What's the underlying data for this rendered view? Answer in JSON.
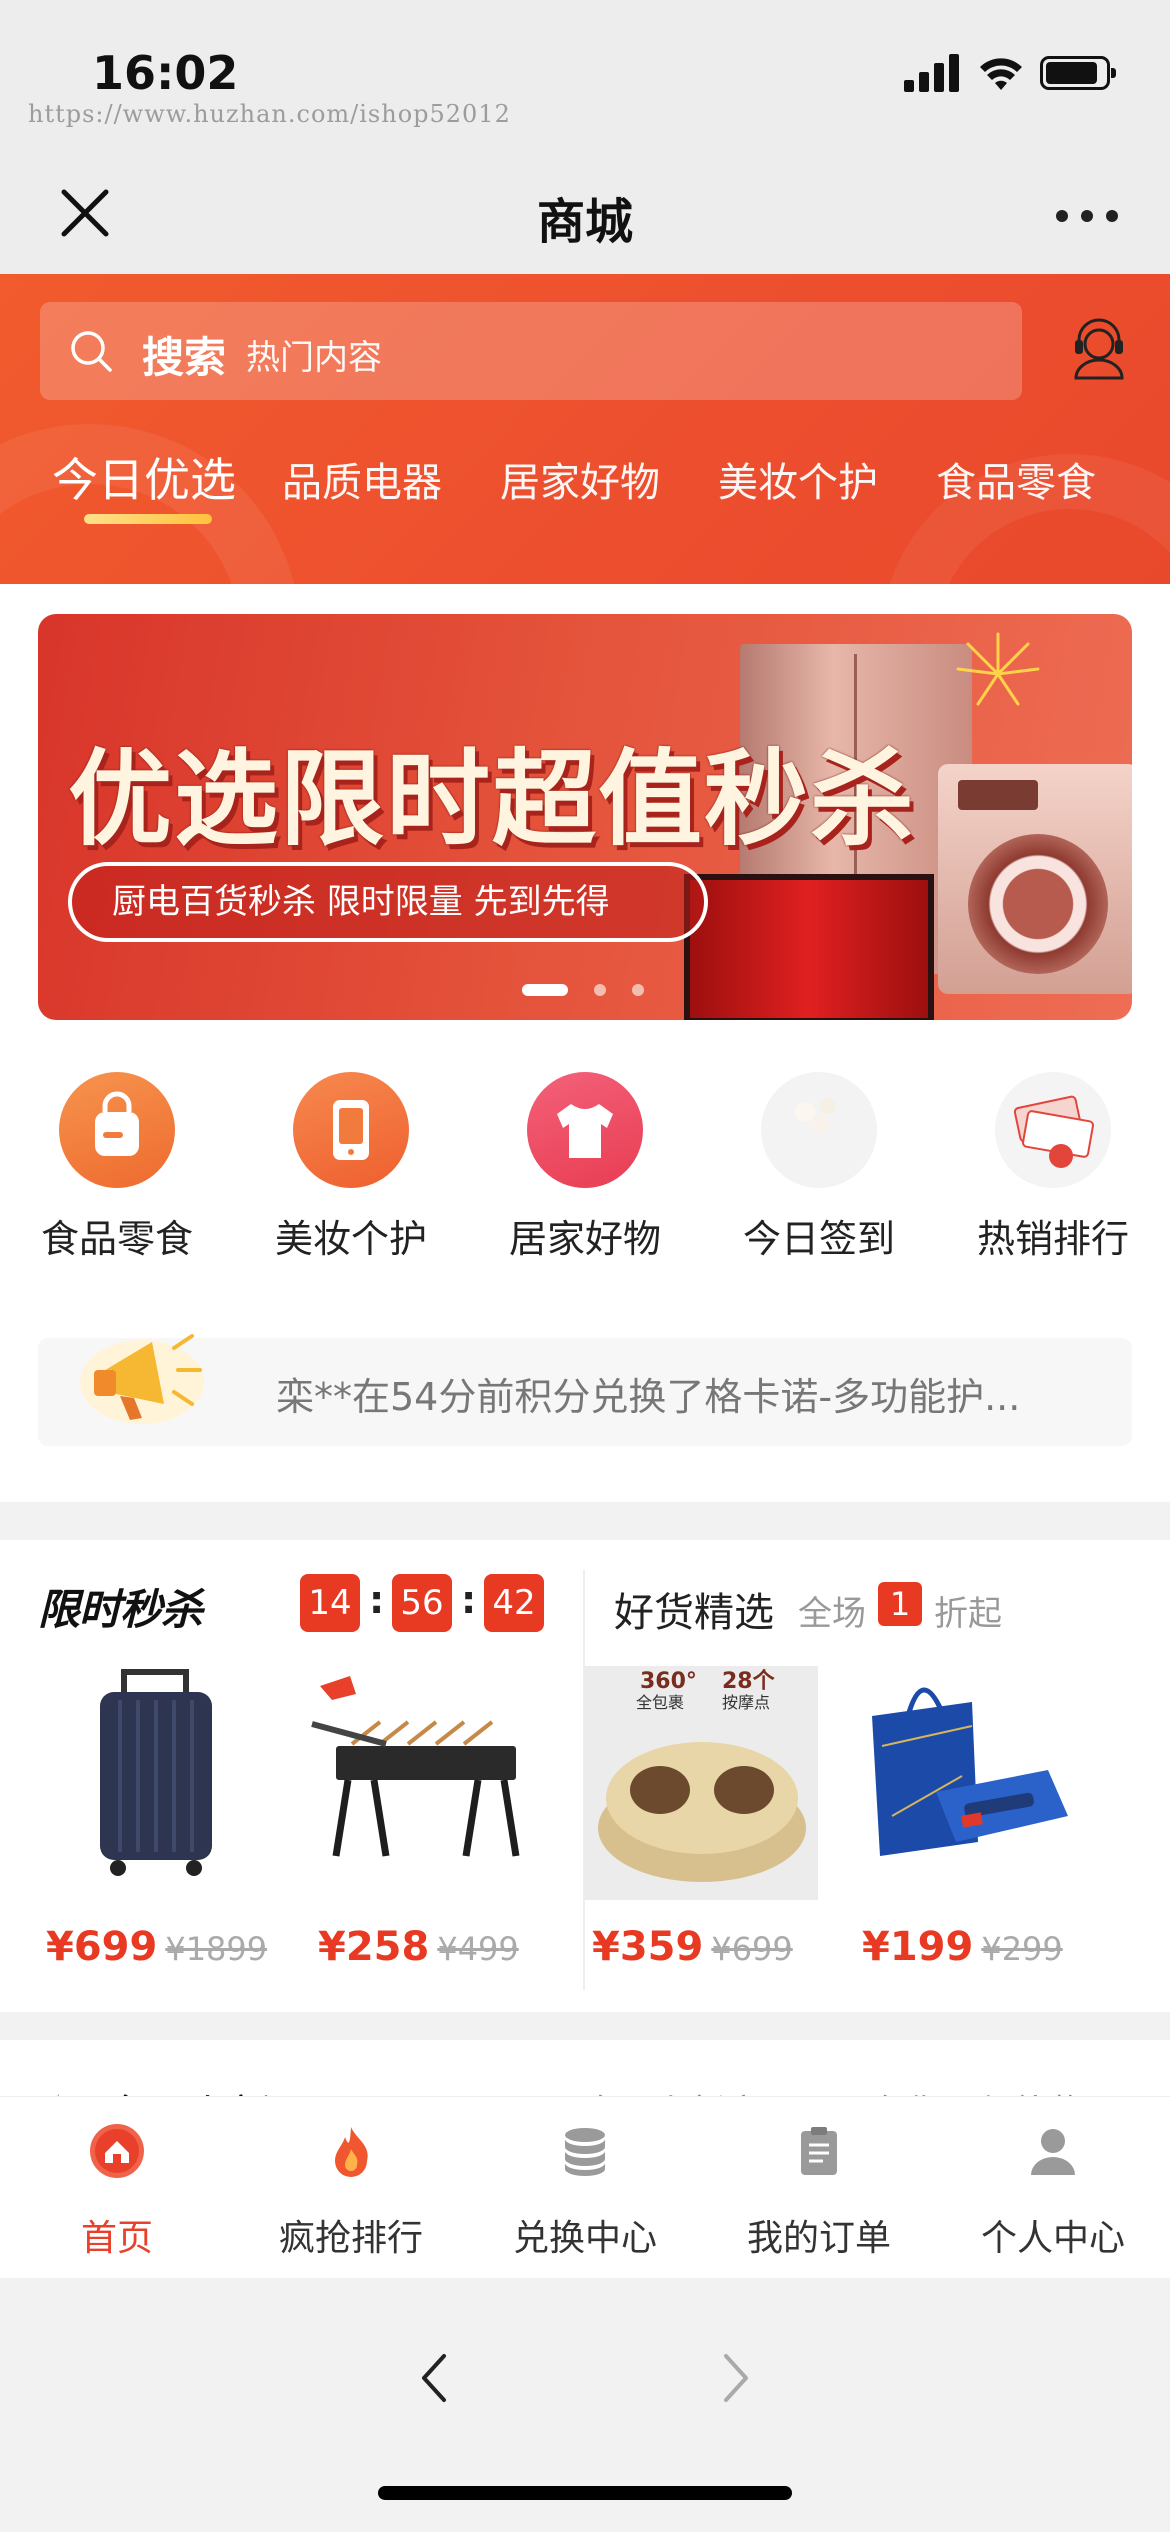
{
  "status_bar": {
    "time": "16:02",
    "url_watermark": "https://www.huzhan.com/ishop52012"
  },
  "nav": {
    "title": "商城"
  },
  "search": {
    "label": "搜索",
    "placeholder": "热门内容"
  },
  "tabs": [
    {
      "label": "今日优选",
      "active": true
    },
    {
      "label": "品质电器"
    },
    {
      "label": "居家好物"
    },
    {
      "label": "美妆个护"
    },
    {
      "label": "食品零食"
    }
  ],
  "banner": {
    "title": "优选限时超值秒杀",
    "subtitle": "厨电百货秒杀 限时限量 先到先得",
    "slide_count": 3,
    "active_slide": 1
  },
  "quick_icons": [
    {
      "label": "食品零食",
      "icon": "backpack-icon",
      "color": "#f07b3c"
    },
    {
      "label": "美妆个护",
      "icon": "phone-icon",
      "color": "#f0703a"
    },
    {
      "label": "居家好物",
      "icon": "shirt-icon",
      "color": "#ee4f62"
    },
    {
      "label": "今日签到",
      "icon": "coins-icon",
      "color": "#f0f0f0"
    },
    {
      "label": "热销排行",
      "icon": "coupon-icon",
      "color": "#f2f2f2"
    }
  ],
  "notice": {
    "text": "栾**在54分前积分兑换了格卡诺-多功能护..."
  },
  "flash_sale": {
    "title": "限时秒杀",
    "countdown": {
      "h": "14",
      "m": "56",
      "s": "42"
    },
    "products": [
      {
        "name": "luggage",
        "price": "¥699",
        "original": "¥1899"
      },
      {
        "name": "grill",
        "price": "¥258",
        "original": "¥499"
      }
    ]
  },
  "good_picks": {
    "title": "好货精选",
    "sub_pre": "全场",
    "badge": "1",
    "sub_post": "折起",
    "products": [
      {
        "name": "foot-massager",
        "tag1_big": "360°",
        "tag1_small": "全包裹",
        "tag2_big": "28个",
        "tag2_small": "按摩点",
        "price": "¥359",
        "original": "¥699"
      },
      {
        "name": "gift-box",
        "price": "¥199",
        "original": "¥299"
      }
    ]
  },
  "new_section": {
    "title": "今日上新",
    "subtitle": "今日上新商品是否有你心仪礼物"
  },
  "tabbar": [
    {
      "label": "首页",
      "icon": "home-icon",
      "active": true
    },
    {
      "label": "疯抢排行",
      "icon": "fire-icon"
    },
    {
      "label": "兑换中心",
      "icon": "database-icon"
    },
    {
      "label": "我的订单",
      "icon": "clipboard-icon"
    },
    {
      "label": "个人中心",
      "icon": "user-icon"
    }
  ],
  "colors": {
    "brand": "#ee5230",
    "accent_red": "#e83a23",
    "underline": "#ffc23d"
  }
}
